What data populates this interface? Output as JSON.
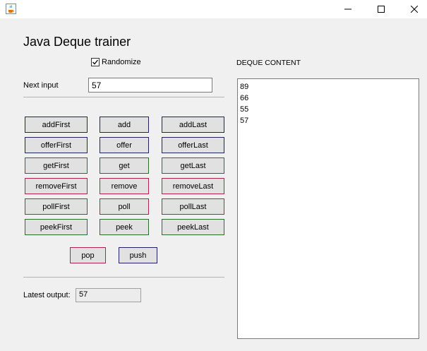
{
  "window": {
    "icon": "java-cup-icon",
    "controls": {
      "minimize": "minimize-icon",
      "maximize": "maximize-icon",
      "close": "close-icon"
    }
  },
  "app": {
    "title": "Java Deque trainer"
  },
  "randomize": {
    "label": "Randomize",
    "checked": true
  },
  "next_input": {
    "label": "Next input",
    "value": "57"
  },
  "operations": {
    "addFirst": "addFirst",
    "add": "add",
    "addLast": "addLast",
    "offerFirst": "offerFirst",
    "offer": "offer",
    "offerLast": "offerLast",
    "getFirst": "getFirst",
    "get": "get",
    "getLast": "getLast",
    "removeFirst": "removeFirst",
    "remove": "remove",
    "removeLast": "removeLast",
    "pollFirst": "pollFirst",
    "poll": "poll",
    "pollLast": "pollLast",
    "peekFirst": "peekFirst",
    "peek": "peek",
    "peekLast": "peekLast",
    "pop": "pop",
    "push": "push"
  },
  "colors": {
    "insert": "#1f2366",
    "retrieve": "#2a6e2f",
    "remove": "#b0244a"
  },
  "latest_output": {
    "label": "Latest output:",
    "value": "57"
  },
  "deque": {
    "label": "DEQUE CONTENT",
    "items": [
      "89",
      "66",
      "55",
      "57"
    ]
  }
}
